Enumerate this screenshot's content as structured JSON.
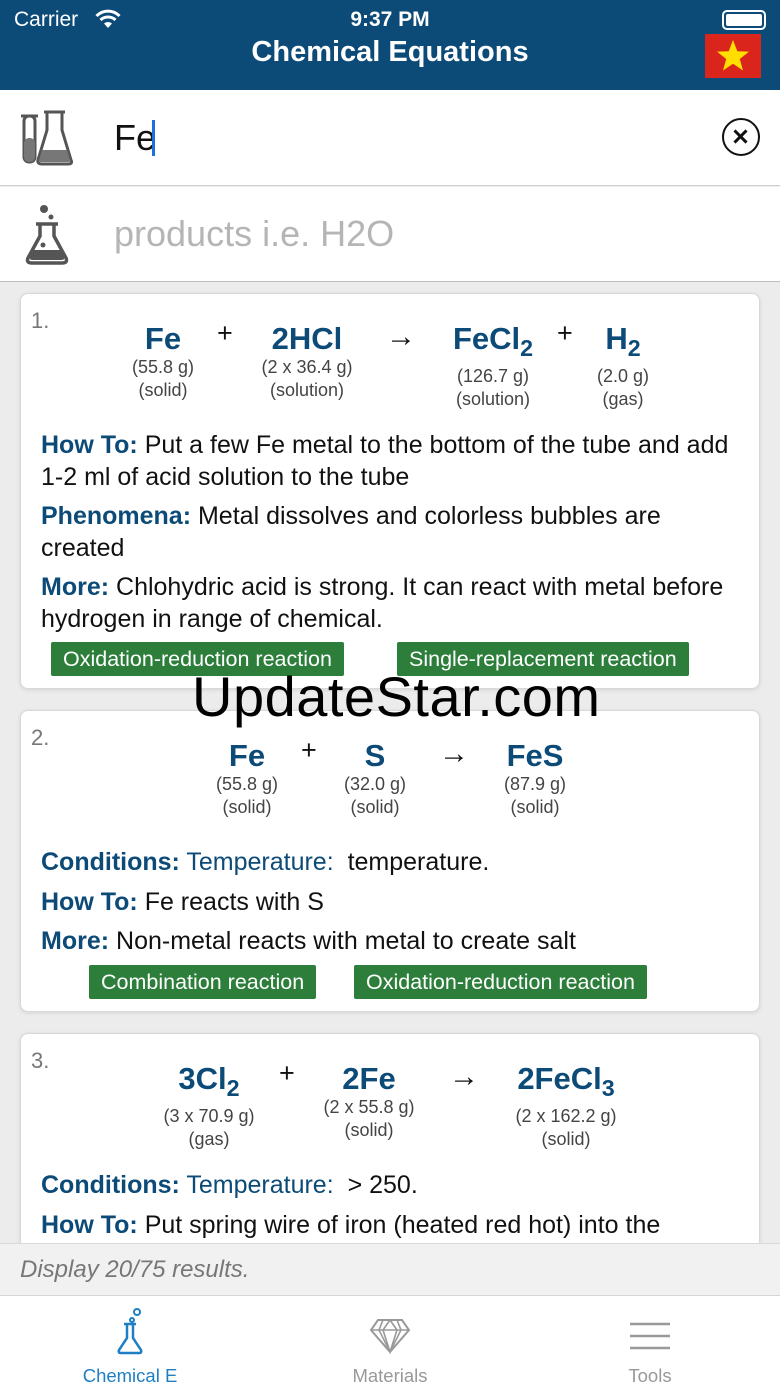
{
  "status_bar": {
    "carrier": "Carrier",
    "time": "9:37 PM"
  },
  "header": {
    "title": "Chemical Equations",
    "flag_icon": "vietnam-flag"
  },
  "search": {
    "reactants_value": "Fe",
    "products_placeholder": "products i.e. H2O"
  },
  "results": [
    {
      "index": "1.",
      "terms": [
        {
          "formula": "Fe",
          "mass": "(55.8 g)",
          "state": "(solid)"
        },
        {
          "formula": "2HCl",
          "mass": "(2 x 36.4 g)",
          "state": "(solution)"
        },
        {
          "formula": "FeCl",
          "sub": "2",
          "mass": "(126.7 g)",
          "state": "(solution)"
        },
        {
          "formula": "H",
          "sub": "2",
          "mass": "(2.0 g)",
          "state": "(gas)"
        }
      ],
      "plus": "+",
      "arrow": "→",
      "how_to_label": "How To:",
      "how_to": "Put a few Fe metal to the bottom of the tube and add 1-2 ml of acid solution to the tube",
      "phenomena_label": "Phenomena:",
      "phenomena": "Metal dissolves and colorless bubbles are created",
      "more_label": "More:",
      "more": "Chlohydric acid is strong. It can react with metal before hydrogen in range of chemical.",
      "tags": [
        "Oxidation-reduction reaction",
        "Single-replacement reaction"
      ]
    },
    {
      "index": "2.",
      "terms": [
        {
          "formula": "Fe",
          "mass": "(55.8 g)",
          "state": "(solid)"
        },
        {
          "formula": "S",
          "mass": "(32.0 g)",
          "state": "(solid)"
        },
        {
          "formula": "FeS",
          "mass": "(87.9 g)",
          "state": "(solid)"
        }
      ],
      "plus": "+",
      "arrow": "→",
      "conditions_label": "Conditions:",
      "conditions_key": "Temperature:",
      "conditions_value": "temperature.",
      "how_to_label": "How To:",
      "how_to": "Fe reacts with S",
      "more_label": "More:",
      "more": "Non-metal reacts with metal to create salt",
      "tags": [
        "Combination reaction",
        "Oxidation-reduction reaction"
      ]
    },
    {
      "index": "3.",
      "terms": [
        {
          "formula": "3Cl",
          "sub": "2",
          "mass": "(3 x 70.9 g)",
          "state": "(gas)"
        },
        {
          "formula": "2Fe",
          "mass": "(2 x 55.8 g)",
          "state": "(solid)"
        },
        {
          "formula": "2FeCl",
          "sub": "3",
          "mass": "(2 x 162.2 g)",
          "state": "(solid)"
        }
      ],
      "plus": "+",
      "arrow": "→",
      "conditions_label": "Conditions:",
      "conditions_key": "Temperature:",
      "conditions_value": "> 250.",
      "how_to_label": "How To:",
      "how_to": "Put spring wire of iron (heated red hot) into the"
    }
  ],
  "watermark": "UpdateStar.com",
  "results_count": "Display 20/75 results.",
  "tabs": [
    {
      "label": "Chemical E",
      "icon": "flask-icon",
      "active": true
    },
    {
      "label": "Materials",
      "icon": "diamond-icon",
      "active": false
    },
    {
      "label": "Tools",
      "icon": "menu-icon",
      "active": false
    }
  ],
  "colors": {
    "header": "#0c4a78",
    "accent": "#0c4a78",
    "tag": "#2c7e3a",
    "tab_active": "#1f7fc4",
    "tab_inactive": "#999999"
  }
}
